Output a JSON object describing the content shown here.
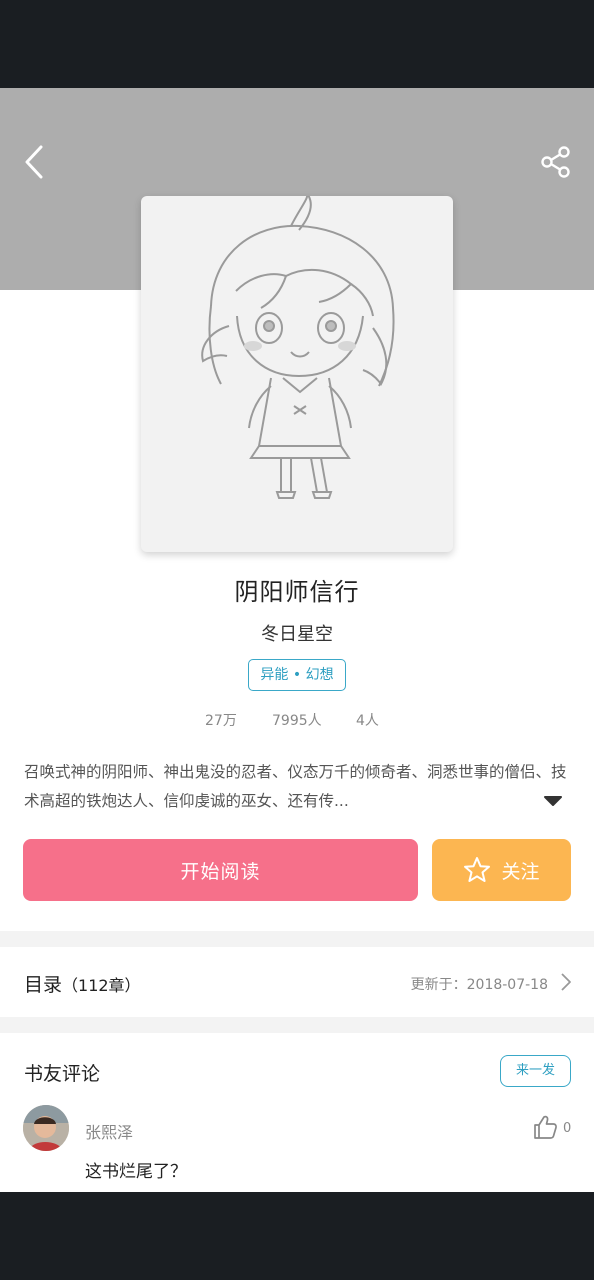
{
  "book": {
    "title": "阴阳师信行",
    "author": "冬日星空",
    "tag": "异能 • 幻想",
    "stats": {
      "words": "27万",
      "readers": "7995人",
      "followers": "4人"
    },
    "description": "召唤式神的阴阳师、神出鬼没的忍者、仪态万千的倾奇者、洞悉世事的僧侣、技术高超的铁炮达人、信仰虔诚的巫女、还有传..."
  },
  "actions": {
    "read_label": "开始阅读",
    "follow_label": "关注"
  },
  "toc": {
    "title": "目录",
    "count": "（112章）",
    "updated": "更新于：2018-07-18"
  },
  "comments": {
    "title": "书友评论",
    "write_label": "来一发",
    "items": [
      {
        "user": "张熙泽",
        "likes": "0",
        "text": "这书烂尾了？"
      }
    ]
  },
  "colors": {
    "accent_pink": "#f6708a",
    "accent_orange": "#fcb651",
    "accent_blue": "#2e9fc1",
    "header_gray": "#adadad"
  },
  "icons": [
    "back-icon",
    "share-icon",
    "expand-icon",
    "star-icon",
    "chevron-right-icon",
    "thumbs-up-icon"
  ]
}
